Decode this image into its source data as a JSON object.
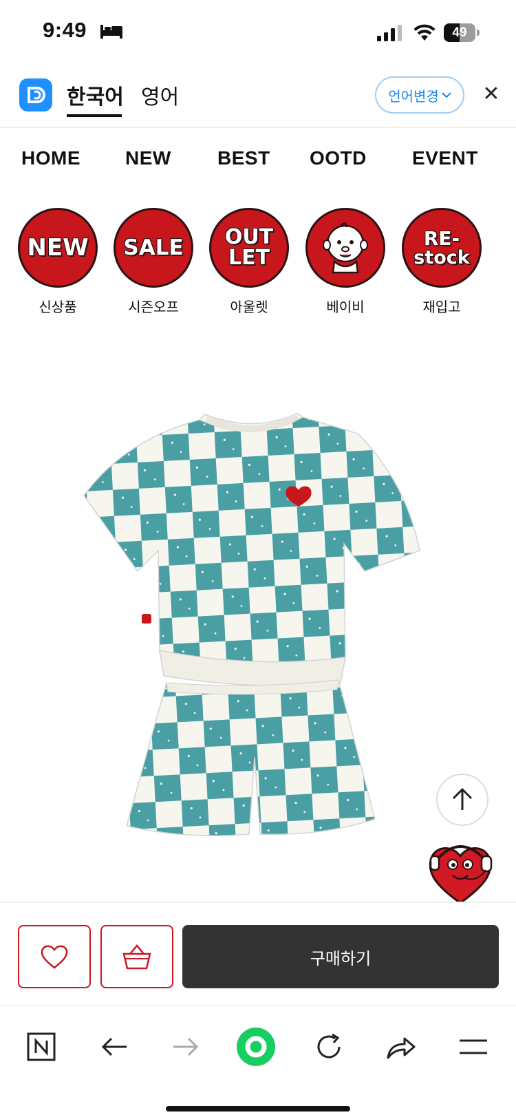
{
  "status_bar": {
    "time": "9:49",
    "battery_level": "49",
    "icons": [
      "bed-icon",
      "signal-icon",
      "wifi-icon",
      "battery-icon"
    ]
  },
  "lang_bar": {
    "tabs": [
      {
        "label": "한국어",
        "active": true
      },
      {
        "label": "영어",
        "active": false
      }
    ],
    "change_label": "언어변경",
    "icons": [
      "papago-icon",
      "chevron-down-icon",
      "close-icon"
    ],
    "accent": "#1a86f0"
  },
  "nav": {
    "items": [
      "HOME",
      "NEW",
      "BEST",
      "OOTD",
      "EVENT"
    ]
  },
  "categories": [
    {
      "art": "NEW",
      "label": "신상품"
    },
    {
      "art": "SALE",
      "label": "시즌오프"
    },
    {
      "art_lines": [
        "OUT",
        "LET"
      ],
      "label": "아울렛"
    },
    {
      "art": "baby-face-icon",
      "label": "베이비"
    },
    {
      "art_lines": [
        "RE-",
        "stock"
      ],
      "label": "재입고"
    }
  ],
  "product": {
    "image": "checkered-tee-shorts-set",
    "colors": {
      "check": "#4a9fa5",
      "base": "#f6f5ee",
      "brand_red": "#c8161d"
    }
  },
  "floating": {
    "icons": [
      "arrow-up-icon",
      "chatbot-mascot-icon"
    ]
  },
  "actions": {
    "buy_label": "구매하기",
    "icons": [
      "heart-icon",
      "basket-icon"
    ]
  },
  "toolbar": {
    "icons": [
      "naver-n-icon",
      "back-arrow-icon",
      "forward-arrow-icon",
      "naver-green-dot-icon",
      "reload-icon",
      "share-icon",
      "menu-icon"
    ]
  }
}
